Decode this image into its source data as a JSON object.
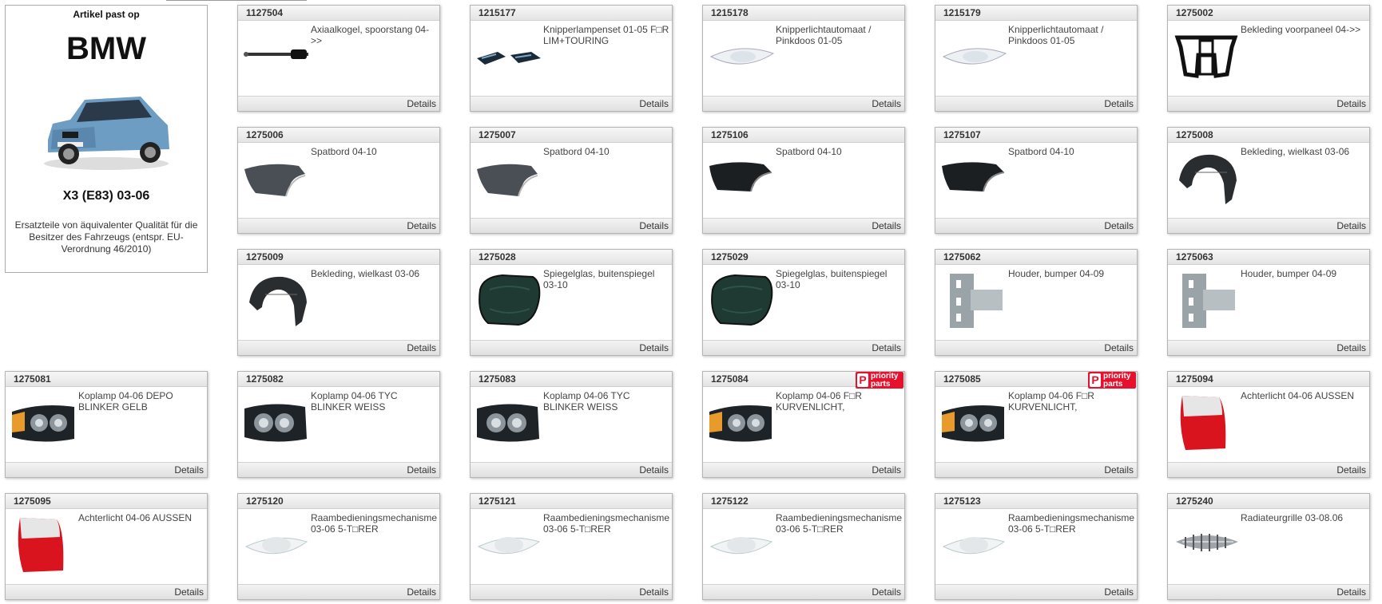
{
  "sidebar": {
    "heading": "Artikel past op",
    "brand": "BMW",
    "model": "X3 (E83) 03-06",
    "note": "Ersatzteile von äquivalenter Qualität für die Besitzer des Fahrzeugs (entspr. EU-Verordnung 46/2010)"
  },
  "details_label": "Details",
  "badge": {
    "p": "P",
    "line1": "priority",
    "line2": "parts"
  },
  "products": [
    {
      "id": "1127504",
      "desc": "Axiaalkogel, spoorstang 04->>",
      "img": "tierod",
      "row": 0,
      "col": 1
    },
    {
      "id": "1215177",
      "desc": "Knipperlampenset 01-05 F□R LIM+TOURING",
      "img": "blinkerset",
      "row": 0,
      "col": 2
    },
    {
      "id": "1215178",
      "desc": "Knipperlichtautomaat / Pinkdoos 01-05",
      "img": "clearlamp",
      "row": 0,
      "col": 3
    },
    {
      "id": "1215179",
      "desc": "Knipperlichtautomaat / Pinkdoos 01-05",
      "img": "clearlamp",
      "row": 0,
      "col": 4
    },
    {
      "id": "1275002",
      "desc": "Bekleding voorpaneel 04->>",
      "img": "panel",
      "row": 0,
      "col": 5
    },
    {
      "id": "1275006",
      "desc": "Spatbord 04-10",
      "img": "fender",
      "row": 1,
      "col": 1
    },
    {
      "id": "1275007",
      "desc": "Spatbord 04-10",
      "img": "fender",
      "row": 1,
      "col": 2
    },
    {
      "id": "1275106",
      "desc": "Spatbord 04-10",
      "img": "fenderdark",
      "row": 1,
      "col": 3
    },
    {
      "id": "1275107",
      "desc": "Spatbord 04-10",
      "img": "fenderdark",
      "row": 1,
      "col": 4
    },
    {
      "id": "1275008",
      "desc": "Bekleding, wielkast 03-06",
      "img": "liner",
      "row": 1,
      "col": 5
    },
    {
      "id": "1275009",
      "desc": "Bekleding, wielkast 03-06",
      "img": "liner",
      "row": 2,
      "col": 1
    },
    {
      "id": "1275028",
      "desc": "Spiegelglas, buitenspiegel 03-10",
      "img": "mirror",
      "row": 2,
      "col": 2
    },
    {
      "id": "1275029",
      "desc": "Spiegelglas, buitenspiegel 03-10",
      "img": "mirror",
      "row": 2,
      "col": 3
    },
    {
      "id": "1275062",
      "desc": "Houder, bumper 04-09",
      "img": "bracket",
      "row": 2,
      "col": 4
    },
    {
      "id": "1275063",
      "desc": "Houder, bumper 04-09",
      "img": "bracket",
      "row": 2,
      "col": 5
    },
    {
      "id": "1275081",
      "desc": "Koplamp 04-06 DEPO BLINKER GELB",
      "img": "headlampamber",
      "row": 3,
      "col": 0
    },
    {
      "id": "1275082",
      "desc": "Koplamp 04-06 TYC BLINKER WEISS",
      "img": "headlamp",
      "row": 3,
      "col": 1
    },
    {
      "id": "1275083",
      "desc": "Koplamp 04-06 TYC BLINKER WEISS",
      "img": "headlamp",
      "row": 3,
      "col": 2
    },
    {
      "id": "1275084",
      "desc": "Koplamp 04-06 F□R KURVENLICHT,",
      "img": "headlampamber",
      "row": 3,
      "col": 3,
      "priority": true
    },
    {
      "id": "1275085",
      "desc": "Koplamp 04-06 F□R KURVENLICHT,",
      "img": "headlampamber",
      "row": 3,
      "col": 4,
      "priority": true
    },
    {
      "id": "1275094",
      "desc": "Achterlicht 04-06 AUSSEN",
      "img": "taillight",
      "row": 3,
      "col": 5
    },
    {
      "id": "1275095",
      "desc": "Achterlicht 04-06 AUSSEN",
      "img": "taillight",
      "row": 4,
      "col": 0
    },
    {
      "id": "1275120",
      "desc": "Raambedieningsmechanisme 03-06 5-T□RER",
      "img": "placeholder",
      "row": 4,
      "col": 1
    },
    {
      "id": "1275121",
      "desc": "Raambedieningsmechanisme 03-06 5-T□RER",
      "img": "placeholder",
      "row": 4,
      "col": 2
    },
    {
      "id": "1275122",
      "desc": "Raambedieningsmechanisme 03-06 5-T□RER",
      "img": "placeholder",
      "row": 4,
      "col": 3
    },
    {
      "id": "1275123",
      "desc": "Raambedieningsmechanisme 03-06 5-T□RER",
      "img": "placeholder",
      "row": 4,
      "col": 4
    },
    {
      "id": "1275240",
      "desc": "Radiateurgrille 03-08.06",
      "img": "grille",
      "row": 4,
      "col": 5
    }
  ]
}
